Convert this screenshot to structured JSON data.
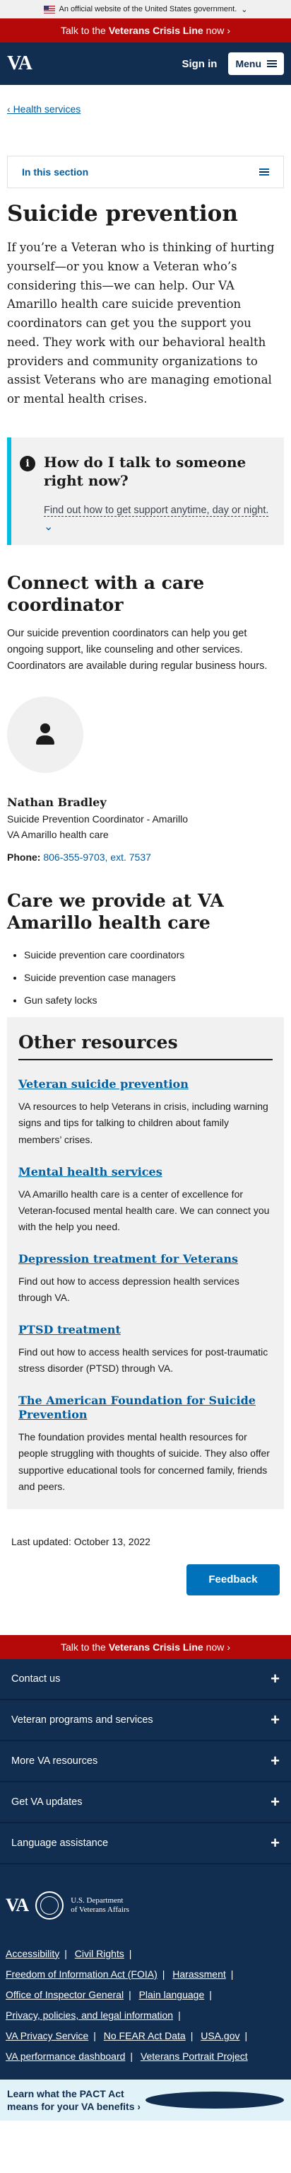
{
  "gov_banner": {
    "text": "An official website of the United States government.",
    "chevron": "chevron-down-icon"
  },
  "crisis_bar": {
    "prefix": "Talk to the ",
    "emphasis": "Veterans Crisis Line",
    "suffix": " now",
    "arrow": "›"
  },
  "header": {
    "logo": "VA",
    "sign_in": "Sign in",
    "menu": "Menu"
  },
  "breadcrumb": {
    "back": "‹",
    "label": "Health services"
  },
  "section_nav": {
    "label": "In this section"
  },
  "page": {
    "title": "Suicide prevention",
    "lead": "If you’re a Veteran who is thinking of hurting yourself—or you know a Veteran who’s considering this—we can help. Our VA Amarillo health care suicide prevention coordinators can get you the support you need. They work with our behavioral health providers and community organizations to assist Veterans who are managing emotional or mental health crises."
  },
  "callout": {
    "title": "How do I talk to someone right now?",
    "text": "Find out how to get support anytime, day or night.",
    "chevron": "⌄"
  },
  "coordinator": {
    "heading": "Connect with a care coordinator",
    "intro": "Our suicide prevention coordinators can help you get ongoing support, like counseling and other services. Coordinators are available during regular business hours.",
    "name": "Nathan Bradley",
    "role": "Suicide Prevention Coordinator - Amarillo",
    "facility": "VA Amarillo health care",
    "phone_label": "Phone:",
    "phone": "806-355-9703, ext. 7537"
  },
  "care": {
    "heading": "Care we provide at VA Amarillo health care",
    "items": [
      "Suicide prevention care coordinators",
      "Suicide prevention case managers",
      "Gun safety locks"
    ]
  },
  "resources": {
    "heading": "Other resources",
    "items": [
      {
        "title": "Veteran suicide prevention",
        "desc": "VA resources to help Veterans in crisis, including warning signs and tips for talking to children about family members’ crises."
      },
      {
        "title": "Mental health services",
        "desc": "VA Amarillo health care is a center of excellence for Veteran-focused mental health care. We can connect you with the help you need."
      },
      {
        "title": "Depression treatment for Veterans",
        "desc": "Find out how to access depression health services through VA."
      },
      {
        "title": "PTSD treatment",
        "desc": "Find out how to access health services for post-traumatic stress disorder (PTSD) through VA."
      },
      {
        "title": "The American Foundation for Suicide Prevention",
        "desc": "The foundation provides mental health resources for people struggling with thoughts of suicide. They also offer supportive educational tools for concerned family, friends and peers."
      }
    ]
  },
  "last_updated": "Last updated: October 13, 2022",
  "feedback": "Feedback",
  "footer": {
    "accordions": [
      "Contact us",
      "Veteran programs and services",
      "More VA resources",
      "Get VA updates",
      "Language assistance"
    ],
    "plus": "+",
    "logo": "VA",
    "dept_line1": "U.S. Department",
    "dept_line2": "of Veterans Affairs",
    "links": [
      "Accessibility",
      "Civil Rights",
      "Freedom of Information Act (FOIA)",
      "Harassment",
      "Office of Inspector General",
      "Plain language",
      "Privacy, policies, and legal information",
      "VA Privacy Service",
      "No FEAR Act Data",
      "USA.gov",
      "VA performance dashboard",
      "Veterans Portrait Project"
    ],
    "sep": "|"
  },
  "pact": {
    "text": "Learn what the PACT Act means for your VA benefits ›",
    "close": "✕"
  }
}
